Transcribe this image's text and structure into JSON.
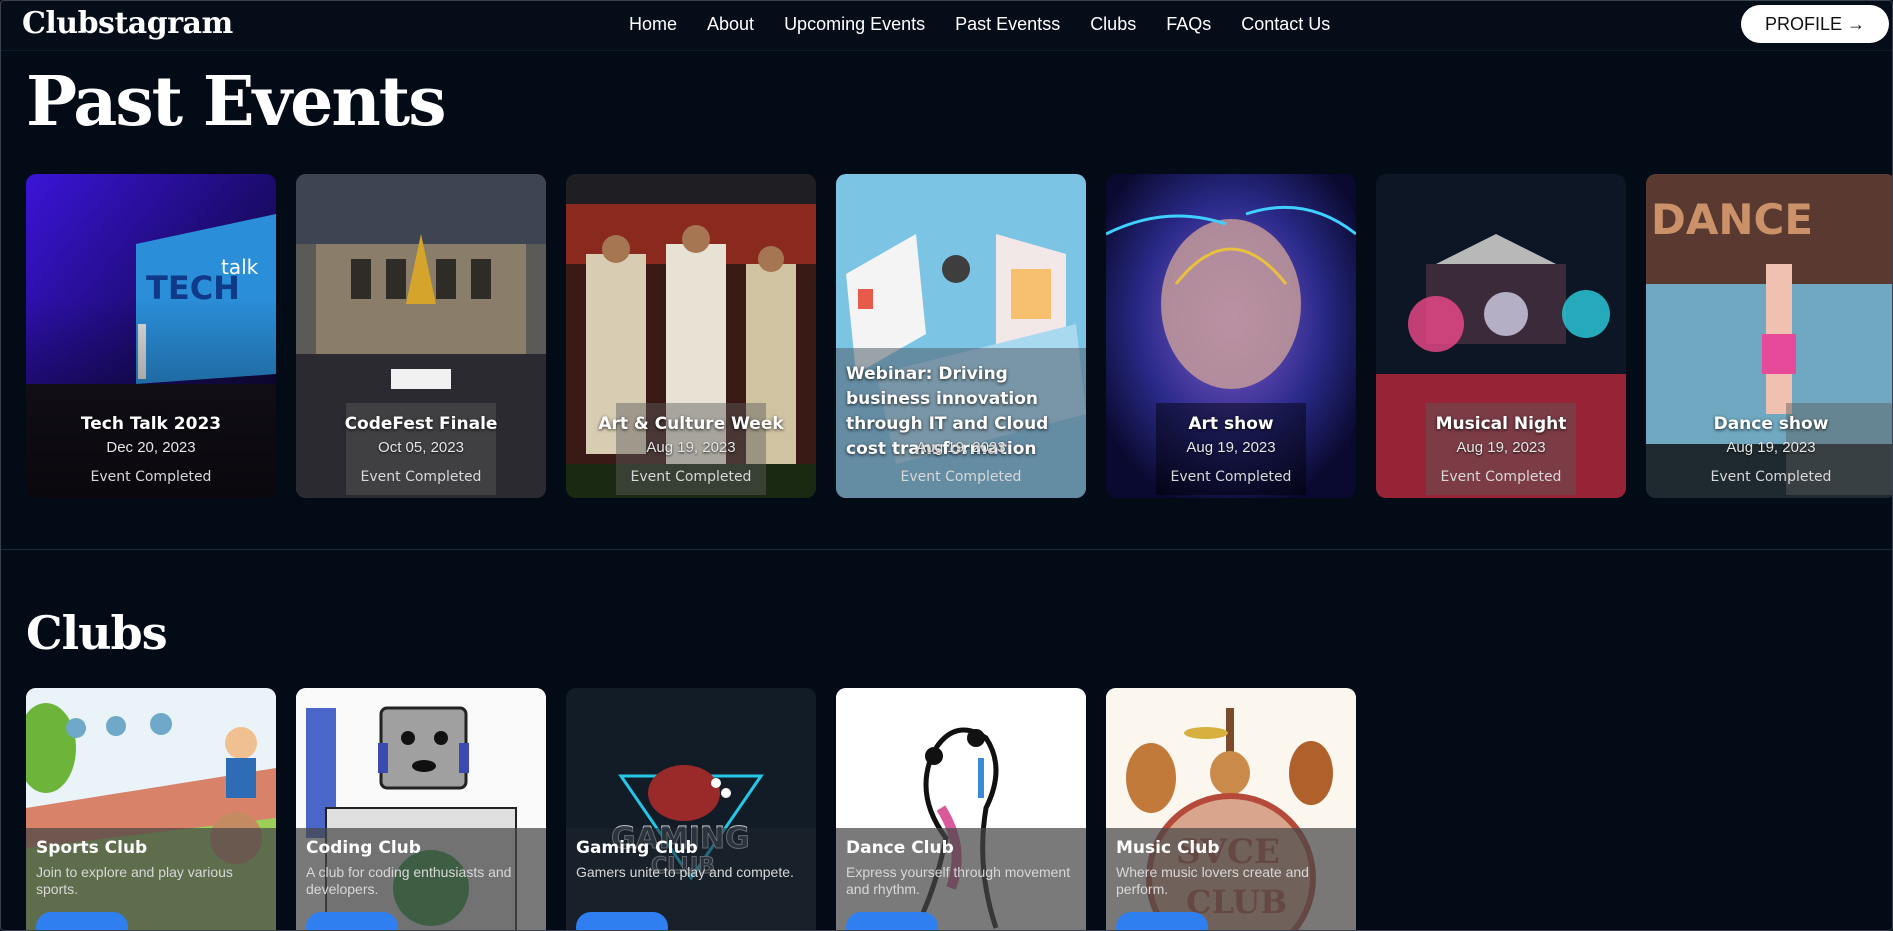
{
  "brand": "Clubstagram",
  "nav": {
    "links": [
      "Home",
      "About",
      "Upcoming Events",
      "Past Eventss",
      "Clubs",
      "FAQs",
      "Contact Us"
    ],
    "profile_label": "PROFILE →"
  },
  "past_events": {
    "title": "Past Events",
    "items": [
      {
        "title": "Tech Talk 2023",
        "date": "Dec 20, 2023",
        "status": "Event Completed"
      },
      {
        "title": "CodeFest Finale",
        "date": "Oct 05, 2023",
        "status": "Event Completed"
      },
      {
        "title": "Art & Culture Week",
        "date": "Aug 19, 2023",
        "status": "Event Completed"
      },
      {
        "title": "Webinar: Driving business innovation through IT and Cloud cost transformation",
        "date": "Aug 19, 2023",
        "status": "Event Completed"
      },
      {
        "title": "Art show",
        "date": "Aug 19, 2023",
        "status": "Event Completed"
      },
      {
        "title": "Musical Night",
        "date": "Aug 19, 2023",
        "status": "Event Completed"
      },
      {
        "title": "Dance show",
        "date": "Aug 19, 2023",
        "status": "Event Completed"
      }
    ]
  },
  "clubs": {
    "title": "Clubs",
    "items": [
      {
        "name": "Sports Club",
        "description": "Join to explore and play various sports."
      },
      {
        "name": "Coding Club",
        "description": "A club for coding enthusiasts and developers."
      },
      {
        "name": "Gaming Club",
        "description": "Gamers unite to play and compete."
      },
      {
        "name": "Dance Club",
        "description": "Express yourself through movement and rhythm."
      },
      {
        "name": "Music Club",
        "description": "Where music lovers create and perform."
      }
    ]
  }
}
